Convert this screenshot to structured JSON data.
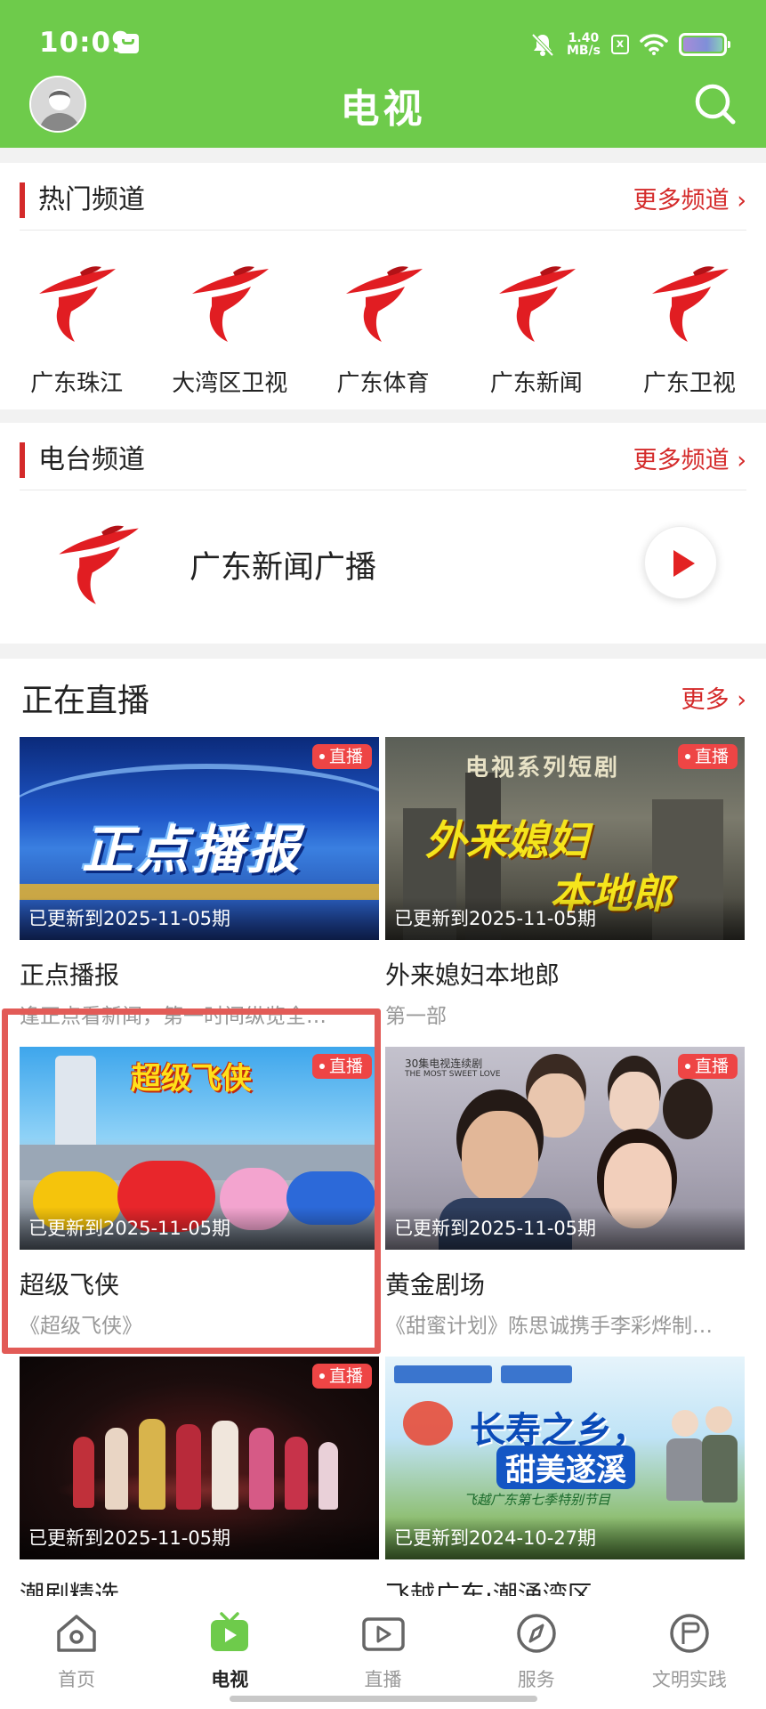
{
  "status_bar": {
    "time": "10:09",
    "net_speed": "1.40",
    "net_unit": "MB/s",
    "box_label": "x"
  },
  "header": {
    "title": "电视"
  },
  "hot_channels": {
    "title": "热门频道",
    "more": "更多频道 ›",
    "items": [
      {
        "name": "广东珠江"
      },
      {
        "name": "大湾区卫视"
      },
      {
        "name": "广东体育"
      },
      {
        "name": "广东新闻"
      },
      {
        "name": "广东卫视"
      }
    ]
  },
  "radio": {
    "title": "电台频道",
    "more": "更多频道 ›",
    "station": "广东新闻广播"
  },
  "live": {
    "title": "正在直播",
    "more": "更多 ›",
    "badge": "直播",
    "tiles": [
      {
        "name": "正点播报",
        "desc": "逢正点看新闻，第一时间纵览全…",
        "updated": "已更新到2025-11-05期",
        "thumb_text": "正点播报",
        "live": true
      },
      {
        "name": "外来媳妇本地郎",
        "desc": "第一部",
        "updated": "已更新到2025-11-05期",
        "thumb_text": "电视系列短剧",
        "thumb_text2": "外来媳妇",
        "thumb_text3": "本地郎",
        "live": true
      },
      {
        "name": "超级飞侠",
        "desc": "《超级飞侠》",
        "updated": "已更新到2025-11-05期",
        "thumb_text": "超级飞侠",
        "live": true
      },
      {
        "name": "黄金剧场",
        "desc": "《甜蜜计划》陈思诚携手李彩烨制…",
        "updated": "已更新到2025-11-05期",
        "thumb_text": "30集电视连续剧",
        "thumb_text2": "THE MOST SWEET LOVE",
        "live": true
      },
      {
        "name": "潮剧精选",
        "desc": "",
        "updated": "已更新到2025-11-05期",
        "live": true
      },
      {
        "name": "飞越广东·潮涌湾区",
        "desc": "",
        "updated": "已更新到2024-10-27期",
        "thumb_text": "长寿之乡，",
        "thumb_text2": "甜美遂溪",
        "thumb_text3": "飞越广东第七季特别节目",
        "live": false
      }
    ]
  },
  "bottom_nav": {
    "items": [
      {
        "label": "首页",
        "icon": "home-icon"
      },
      {
        "label": "电视",
        "icon": "tv-icon",
        "active": true
      },
      {
        "label": "直播",
        "icon": "live-video-icon"
      },
      {
        "label": "服务",
        "icon": "compass-icon"
      },
      {
        "label": "文明实践",
        "icon": "flag-icon"
      }
    ]
  },
  "colors": {
    "accent_green": "#6ecb4b",
    "accent_red": "#d42a2a",
    "badge_red": "#ee4545"
  }
}
